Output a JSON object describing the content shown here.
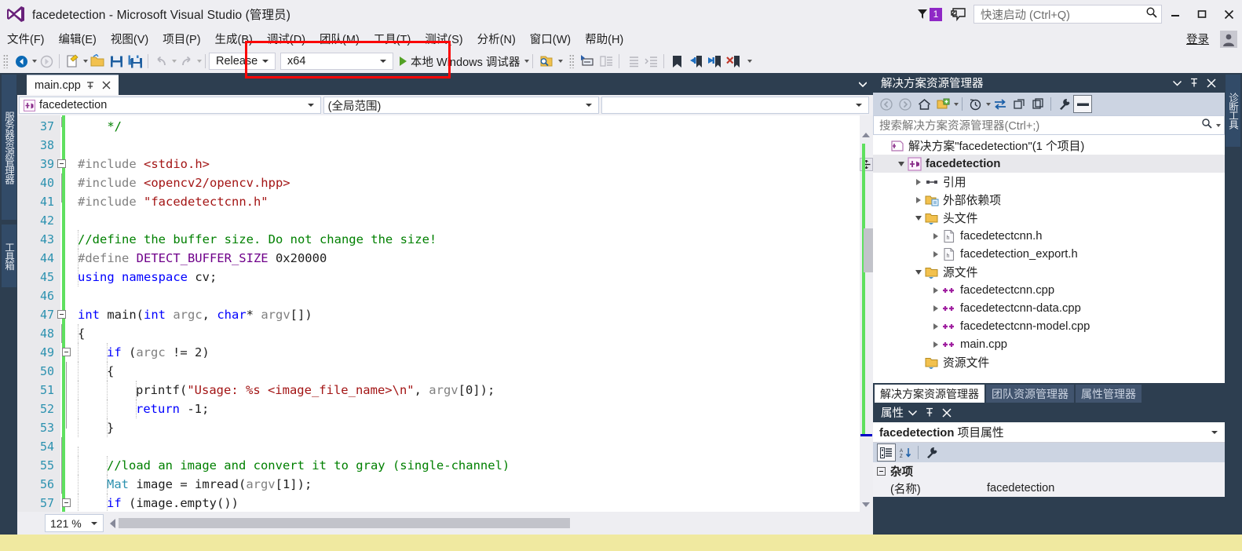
{
  "titlebar": {
    "title": "facedetection - Microsoft Visual Studio (管理员)",
    "logo_icon": "visual-studio-logo-icon",
    "notification_flag_icon": "notification-flag-icon",
    "notification_count": "1",
    "feedback_icon": "send-feedback-icon",
    "quick_launch_placeholder": "快速启动 (Ctrl+Q)",
    "quick_launch_value": "",
    "search_icon": "search-icon",
    "minimize_icon": "minimize-icon",
    "maximize_icon": "maximize-icon",
    "close_icon": "close-icon"
  },
  "menubar": {
    "items": [
      {
        "label": "文件(F)"
      },
      {
        "label": "编辑(E)"
      },
      {
        "label": "视图(V)"
      },
      {
        "label": "项目(P)"
      },
      {
        "label": "生成(B)"
      },
      {
        "label": "调试(D)"
      },
      {
        "label": "团队(M)"
      },
      {
        "label": "工具(T)"
      },
      {
        "label": "测试(S)"
      },
      {
        "label": "分析(N)"
      },
      {
        "label": "窗口(W)"
      },
      {
        "label": "帮助(H)"
      }
    ],
    "signin_label": "登录",
    "account_icon": "account-avatar-icon"
  },
  "toolbar": {
    "navigate_back_icon": "navigate-back-icon",
    "navigate_forward_icon": "navigate-forward-icon",
    "new_project_icon": "new-project-icon",
    "open_file_icon": "open-file-icon",
    "save_icon": "save-icon",
    "save_all_icon": "save-all-icon",
    "undo_icon": "undo-icon",
    "redo_icon": "redo-icon",
    "configuration_value": "Release",
    "platform_value": "x64",
    "start_debug_label": "本地 Windows 调试器",
    "find_in_files_icon": "find-in-files-icon",
    "toggle_outline_icon": "toggle-outline-icon",
    "comment_icon": "comment-selection-icon",
    "uncomment_icon": "uncomment-selection-icon",
    "decrease_indent_icon": "decrease-indent-icon",
    "increase_indent_icon": "increase-indent-icon",
    "bookmark_icon": "toggle-bookmark-icon",
    "prev_bookmark_icon": "previous-bookmark-icon",
    "next_bookmark_icon": "next-bookmark-icon",
    "clear_bookmarks_icon": "clear-bookmarks-icon",
    "overflow_icon": "toolbar-overflow-icon"
  },
  "annotation": {
    "highlight_color": "#fb0707",
    "shape": "rectangle"
  },
  "left_strip": {
    "tabs": [
      {
        "label": "服务器资源管理器"
      },
      {
        "label": "工具箱"
      }
    ]
  },
  "right_strip": {
    "tabs": [
      {
        "label": "诊断工具"
      }
    ]
  },
  "editor": {
    "tab_label": "main.cpp",
    "tab_pin_icon": "pin-icon",
    "tab_close_icon": "close-icon",
    "tab_list_icon": "chevron-down-icon",
    "nav_project": "facedetection",
    "nav_project_icon": "cpp-project-icon",
    "nav_scope": "(全局范围)",
    "nav_member": "",
    "zoom_level": "121 %",
    "lines": [
      {
        "num": "37",
        "fold": "end",
        "indent": 0,
        "tokens": [
          {
            "t": "    ",
            "c": "id"
          },
          {
            "t": "*/",
            "c": "cm"
          }
        ]
      },
      {
        "num": "38",
        "fold": "",
        "indent": 0,
        "tokens": []
      },
      {
        "num": "39",
        "fold": "open",
        "indent": 0,
        "tokens": [
          {
            "t": "#include ",
            "c": "pp"
          },
          {
            "t": "<stdio.h>",
            "c": "st"
          }
        ]
      },
      {
        "num": "40",
        "fold": "line",
        "indent": 0,
        "tokens": [
          {
            "t": "#include ",
            "c": "pp"
          },
          {
            "t": "<opencv2/opencv.hpp>",
            "c": "st"
          }
        ]
      },
      {
        "num": "41",
        "fold": "lineend",
        "indent": 0,
        "tokens": [
          {
            "t": "#include ",
            "c": "pp"
          },
          {
            "t": "\"facedetectcnn.h\"",
            "c": "st"
          }
        ]
      },
      {
        "num": "42",
        "fold": "",
        "indent": 0,
        "tokens": []
      },
      {
        "num": "43",
        "fold": "",
        "indent": 1,
        "tokens": [
          {
            "t": "//define the buffer size. Do not change the size!",
            "c": "cm"
          }
        ]
      },
      {
        "num": "44",
        "fold": "",
        "indent": 1,
        "tokens": [
          {
            "t": "#define ",
            "c": "pp"
          },
          {
            "t": "DETECT_BUFFER_SIZE",
            "c": "mc"
          },
          {
            "t": " 0x20000",
            "c": "num"
          }
        ]
      },
      {
        "num": "45",
        "fold": "",
        "indent": 1,
        "tokens": [
          {
            "t": "using namespace",
            "c": "k"
          },
          {
            "t": " cv;",
            "c": "id"
          }
        ]
      },
      {
        "num": "46",
        "fold": "",
        "indent": 0,
        "tokens": []
      },
      {
        "num": "47",
        "fold": "open",
        "indent": 0,
        "tokens": [
          {
            "t": "int",
            "c": "k"
          },
          {
            "t": " main(",
            "c": "id"
          },
          {
            "t": "int",
            "c": "k"
          },
          {
            "t": " ",
            "c": "id"
          },
          {
            "t": "argc",
            "c": "pm"
          },
          {
            "t": ", ",
            "c": "id"
          },
          {
            "t": "char",
            "c": "k"
          },
          {
            "t": "* ",
            "c": "id"
          },
          {
            "t": "argv",
            "c": "pm"
          },
          {
            "t": "[])",
            "c": "id"
          }
        ]
      },
      {
        "num": "48",
        "fold": "line",
        "indent": 1,
        "tokens": [
          {
            "t": "{",
            "c": "id"
          }
        ]
      },
      {
        "num": "49",
        "fold": "open2",
        "indent": 2,
        "tokens": [
          {
            "t": "if",
            "c": "k"
          },
          {
            "t": " (",
            "c": "id"
          },
          {
            "t": "argc",
            "c": "pm"
          },
          {
            "t": " != 2)",
            "c": "id"
          }
        ]
      },
      {
        "num": "50",
        "fold": "line2",
        "indent": 2,
        "tokens": [
          {
            "t": "{",
            "c": "id"
          }
        ]
      },
      {
        "num": "51",
        "fold": "line2",
        "indent": 3,
        "tokens": [
          {
            "t": "printf(",
            "c": "id"
          },
          {
            "t": "\"Usage: %s <image_file_name>\\n\"",
            "c": "st"
          },
          {
            "t": ", ",
            "c": "id"
          },
          {
            "t": "argv",
            "c": "pm"
          },
          {
            "t": "[0]);",
            "c": "id"
          }
        ]
      },
      {
        "num": "52",
        "fold": "line2",
        "indent": 3,
        "tokens": [
          {
            "t": "return",
            "c": "k"
          },
          {
            "t": " -1;",
            "c": "id"
          }
        ]
      },
      {
        "num": "53",
        "fold": "end2",
        "indent": 2,
        "tokens": [
          {
            "t": "}",
            "c": "id"
          }
        ]
      },
      {
        "num": "54",
        "fold": "line",
        "indent": 1,
        "tokens": []
      },
      {
        "num": "55",
        "fold": "line",
        "indent": 2,
        "tokens": [
          {
            "t": "//load an image and convert it to gray (single-channel)",
            "c": "cm"
          }
        ]
      },
      {
        "num": "56",
        "fold": "line",
        "indent": 2,
        "tokens": [
          {
            "t": "Mat",
            "c": "ty"
          },
          {
            "t": " image = imread(",
            "c": "id"
          },
          {
            "t": "argv",
            "c": "pm"
          },
          {
            "t": "[1]);",
            "c": "id"
          }
        ]
      },
      {
        "num": "57",
        "fold": "open2",
        "indent": 2,
        "tokens": [
          {
            "t": "if",
            "c": "k"
          },
          {
            "t": " (image.empty())",
            "c": "id"
          }
        ]
      }
    ]
  },
  "solution_explorer": {
    "title": "解决方案资源管理器",
    "dropdown_icon": "chevron-down-icon",
    "pin_icon": "pin-icon",
    "close_icon": "close-icon",
    "toolbar": {
      "back_icon": "navigate-back-icon",
      "forward_icon": "navigate-forward-icon",
      "home_icon": "home-icon",
      "pending_changes_icon": "show-all-files-icon",
      "pending_caret_icon": "chevron-down-icon",
      "history_icon": "history-icon",
      "history_caret_icon": "chevron-down-icon",
      "sync_icon": "sync-with-active-document-icon",
      "refresh_icon": "refresh-icon",
      "collapse_all_icon": "collapse-all-icon",
      "properties_icon": "properties-wrench-icon",
      "preview_icon": "preview-selected-items-icon"
    },
    "search_placeholder": "搜索解决方案资源管理器(Ctrl+;)",
    "search_icon": "search-icon",
    "search_caret_icon": "chevron-down-icon",
    "tree": [
      {
        "label": "解决方案\"facedetection\"(1 个项目)",
        "icon": "solution-icon",
        "indent": 0,
        "expander": "none",
        "bold": false,
        "selected": false
      },
      {
        "label": "facedetection",
        "icon": "cpp-project-icon",
        "indent": 1,
        "expander": "open",
        "bold": true,
        "selected": true
      },
      {
        "label": "引用",
        "icon": "references-icon",
        "indent": 2,
        "expander": "closed",
        "bold": false,
        "selected": false
      },
      {
        "label": "外部依赖项",
        "icon": "external-dependencies-icon",
        "indent": 2,
        "expander": "closed",
        "bold": false,
        "selected": false
      },
      {
        "label": "头文件",
        "icon": "filter-folder-icon",
        "indent": 2,
        "expander": "open",
        "bold": false,
        "selected": false
      },
      {
        "label": "facedetectcnn.h",
        "icon": "header-file-icon",
        "indent": 3,
        "expander": "closed",
        "bold": false,
        "selected": false
      },
      {
        "label": "facedetection_export.h",
        "icon": "header-file-icon",
        "indent": 3,
        "expander": "closed",
        "bold": false,
        "selected": false
      },
      {
        "label": "源文件",
        "icon": "filter-folder-icon",
        "indent": 2,
        "expander": "open",
        "bold": false,
        "selected": false
      },
      {
        "label": "facedetectcnn.cpp",
        "icon": "cpp-file-icon",
        "indent": 3,
        "expander": "closed",
        "bold": false,
        "selected": false
      },
      {
        "label": "facedetectcnn-data.cpp",
        "icon": "cpp-file-icon",
        "indent": 3,
        "expander": "closed",
        "bold": false,
        "selected": false
      },
      {
        "label": "facedetectcnn-model.cpp",
        "icon": "cpp-file-icon",
        "indent": 3,
        "expander": "closed",
        "bold": false,
        "selected": false
      },
      {
        "label": "main.cpp",
        "icon": "cpp-file-icon",
        "indent": 3,
        "expander": "closed",
        "bold": false,
        "selected": false
      },
      {
        "label": "资源文件",
        "icon": "filter-folder-icon",
        "indent": 2,
        "expander": "none",
        "bold": false,
        "selected": false
      }
    ],
    "tabs": [
      {
        "label": "解决方案资源管理器",
        "active": true
      },
      {
        "label": "团队资源管理器",
        "active": false
      },
      {
        "label": "属性管理器",
        "active": false
      }
    ]
  },
  "properties": {
    "title": "属性",
    "dropdown_icon": "chevron-down-icon",
    "pin_icon": "pin-icon",
    "close_icon": "close-icon",
    "object_name": "facedetection",
    "object_kind": "项目属性",
    "object_caret_icon": "chevron-down-icon",
    "toolbar": {
      "categorized_icon": "categorized-view-icon",
      "alphabetical_icon": "alphabetical-sort-icon",
      "property_pages_icon": "property-pages-wrench-icon"
    },
    "category": "杂项",
    "rows": [
      {
        "name": "(名称)",
        "value": "facedetection"
      }
    ]
  }
}
